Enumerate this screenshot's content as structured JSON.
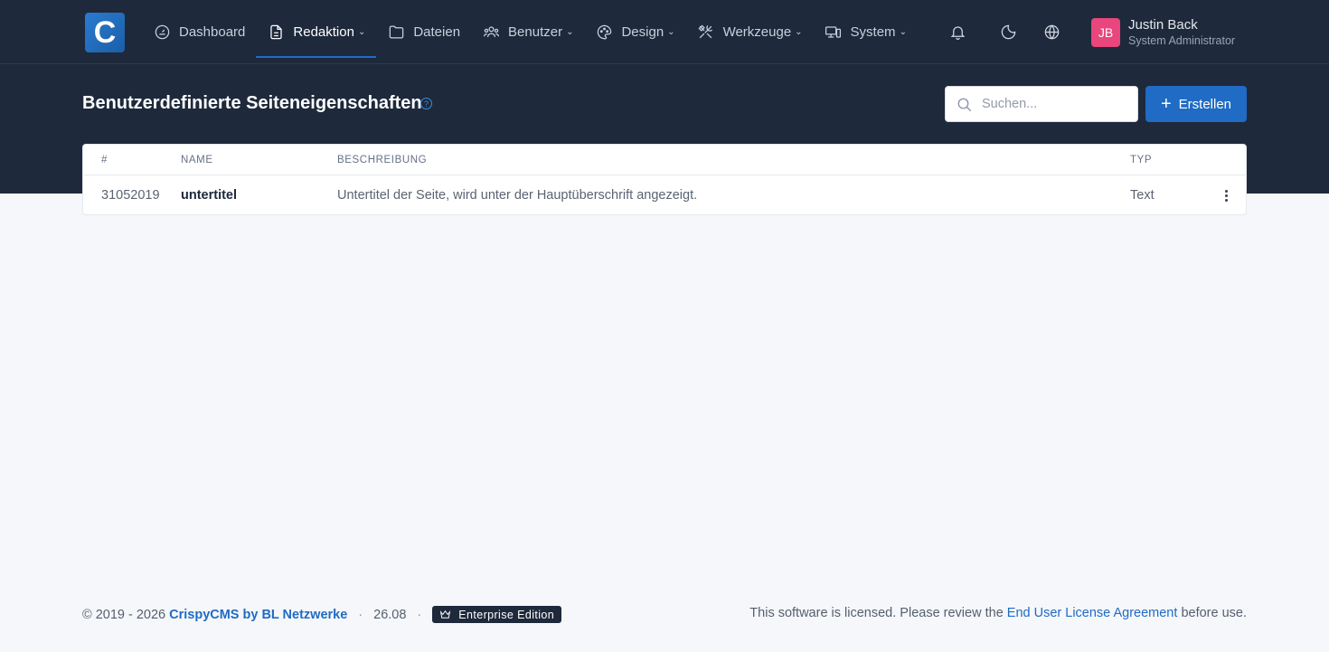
{
  "app": {
    "logo_letter": "C"
  },
  "nav": {
    "items": [
      {
        "label": "Dashboard",
        "icon": "dashboard-icon",
        "has_dropdown": false,
        "active": false
      },
      {
        "label": "Redaktion",
        "icon": "document-icon",
        "has_dropdown": true,
        "active": true
      },
      {
        "label": "Dateien",
        "icon": "folder-icon",
        "has_dropdown": false,
        "active": false
      },
      {
        "label": "Benutzer",
        "icon": "users-icon",
        "has_dropdown": true,
        "active": false
      },
      {
        "label": "Design",
        "icon": "palette-icon",
        "has_dropdown": true,
        "active": false
      },
      {
        "label": "Werkzeuge",
        "icon": "tools-icon",
        "has_dropdown": true,
        "active": false
      },
      {
        "label": "System",
        "icon": "devices-icon",
        "has_dropdown": true,
        "active": false
      }
    ]
  },
  "user": {
    "initials": "JB",
    "name": "Justin Back",
    "role": "System Administrator"
  },
  "page": {
    "title": "Benutzerdefinierte Seiteneigenschaften",
    "help_glyph": "?",
    "search_placeholder": "Suchen...",
    "create_label": "Erstellen"
  },
  "table": {
    "headers": {
      "id": "#",
      "name": "Name",
      "description": "Beschreibung",
      "type": "Typ"
    },
    "rows": [
      {
        "id": "31052019",
        "name": "untertitel",
        "description": "Untertitel der Seite, wird unter der Hauptüberschrift angezeigt.",
        "type": "Text"
      }
    ]
  },
  "footer": {
    "copyright": "© 2019 - 2026",
    "brand": "CrispyCMS by BL Netzwerke",
    "separator": "·",
    "version": "26.08",
    "edition": "Enterprise Edition",
    "license_prefix": "This software is licensed. Please review the",
    "license_link": "End User License Agreement",
    "license_suffix": "before use."
  },
  "colors": {
    "accent": "#206bc4",
    "header_bg": "#1e293b",
    "avatar": "#e8467c"
  }
}
